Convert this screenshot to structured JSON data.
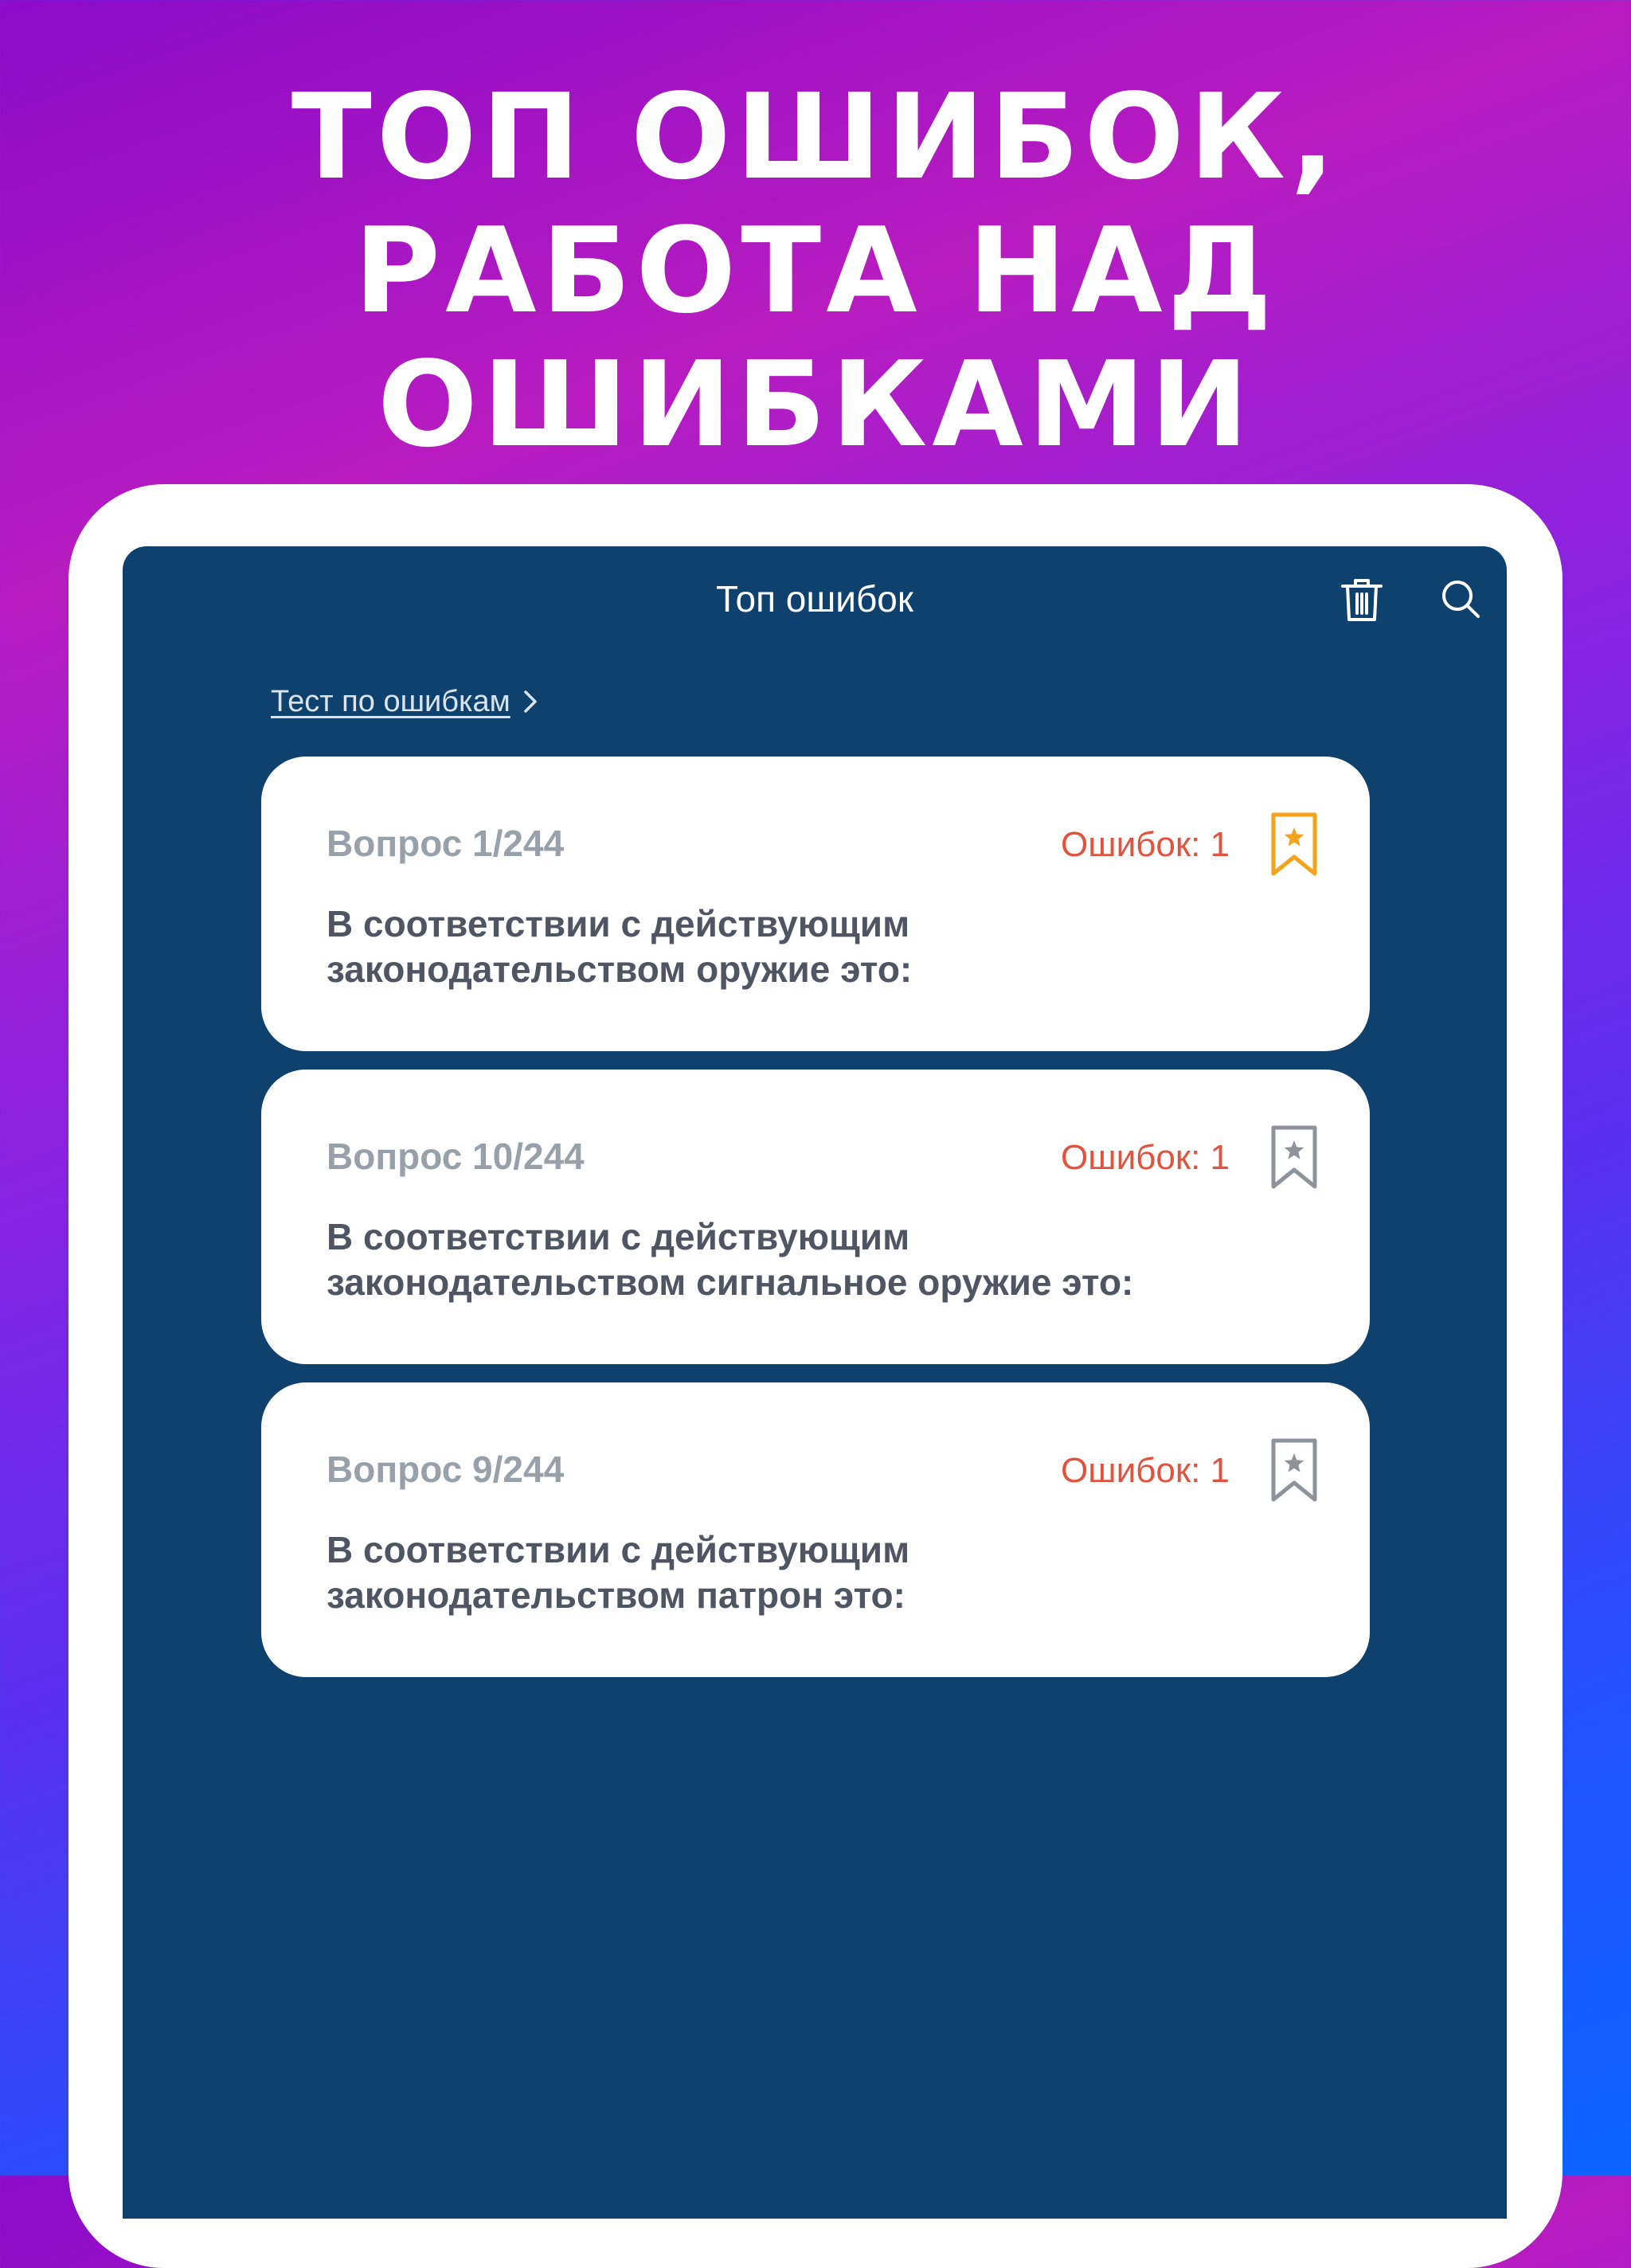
{
  "promo": {
    "headline_lines": [
      "ТОП ОШИБОК,",
      "РАБОТА НАД",
      "ОШИБКАМИ"
    ]
  },
  "nav": {
    "title": "Топ ошибок",
    "icons": [
      "trash-icon",
      "search-icon"
    ]
  },
  "test_link": {
    "label": "Тест по ошибкам",
    "icon": "chevron-right-icon"
  },
  "colors": {
    "screen_background": "#0f416f",
    "card_background": "#ffffff",
    "error_text": "#e0533f",
    "bookmark_active": "#f5a31a",
    "bookmark_inactive": "#8e939b"
  },
  "questions": [
    {
      "number": "Вопрос 1/244",
      "errors": "Ошибок: 1",
      "bookmarked": true,
      "text_lines": [
        "В соответствии с действующим",
        "законодательством оружие это:"
      ]
    },
    {
      "number": "Вопрос 10/244",
      "errors": "Ошибок: 1",
      "bookmarked": false,
      "text_lines": [
        "В соответствии с действующим",
        "законодательством сигнальное оружие это:"
      ]
    },
    {
      "number": "Вопрос 9/244",
      "errors": "Ошибок: 1",
      "bookmarked": false,
      "text_lines": [
        "В соответствии с действующим",
        "законодательством патрон это:"
      ]
    }
  ]
}
